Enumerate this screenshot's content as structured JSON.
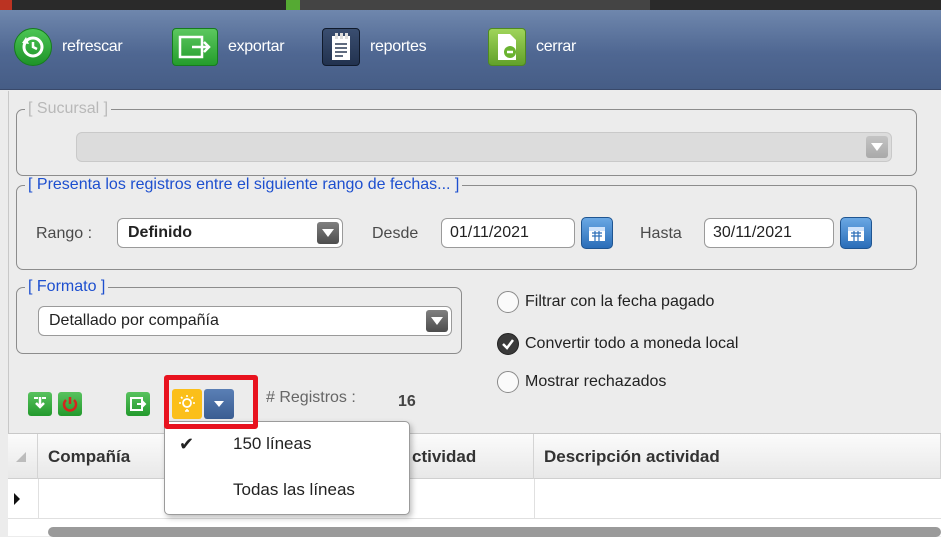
{
  "toolbar": {
    "refresh_label": "refrescar",
    "export_label": "exportar",
    "reports_label": "reportes",
    "close_label": "cerrar"
  },
  "branch": {
    "legend": "[ Sucursal ]",
    "value": ""
  },
  "date_range": {
    "legend": "[ Presenta los registros entre el siguiente rango de fechas... ]",
    "range_label": "Rango :",
    "range_value": "Definido",
    "from_label": "Desde",
    "from_value": "01/11/2021",
    "to_label": "Hasta",
    "to_value": "30/11/2021"
  },
  "format": {
    "legend": "[ Formato ]",
    "value": "Detallado por compañía"
  },
  "options": {
    "filter_paid_date": {
      "label": "Filtrar con la fecha pagado",
      "checked": false
    },
    "convert_local_currency": {
      "label": "Convertir todo a moneda local",
      "checked": true
    },
    "show_rejected": {
      "label": "Mostrar rechazados",
      "checked": false
    }
  },
  "records": {
    "label": "# Registros :",
    "count": "16"
  },
  "grid": {
    "columns": [
      "Compañía",
      "Actividad",
      "Descripción actividad"
    ],
    "column_fragment": "ctividad"
  },
  "lines_menu": {
    "items": [
      {
        "label": "150 líneas",
        "checked": true
      },
      {
        "label": "Todas las líneas",
        "checked": false
      }
    ],
    "check_glyph": "✔"
  },
  "colors": {
    "toolbar_top": "#6f87ad",
    "toolbar_bottom": "#465d86",
    "legend_blue": "#1d4fcf",
    "highlight_red": "#e8121e"
  }
}
